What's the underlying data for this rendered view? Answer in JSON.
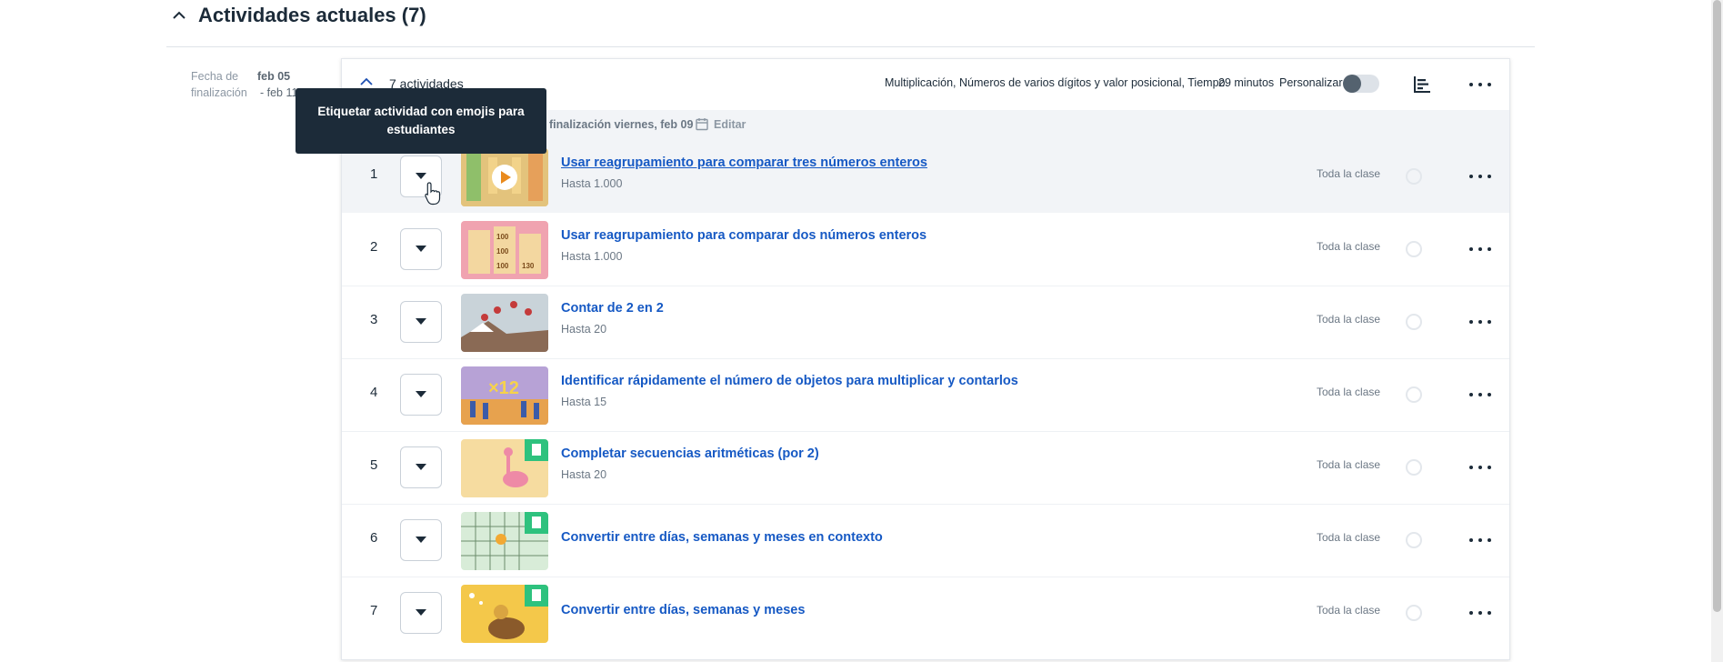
{
  "section": {
    "title": "Actividades actuales (7)"
  },
  "due": {
    "label": "Fecha de finalización",
    "start": "feb 05",
    "end": "- feb 11"
  },
  "card": {
    "count_label": "7 actividades",
    "skills": "Multiplicación, Números de varios dígitos y valor posicional, Tiempo",
    "duration": "29 minutos",
    "personalize_label": "Personalizar",
    "personalize_on": false
  },
  "subbar": {
    "due_text": "finalización viernes, feb 09",
    "edit_label": "Editar"
  },
  "tooltip": {
    "text": "Etiquetar actividad con emojis para estudiantes"
  },
  "activities": [
    {
      "num": "1",
      "title": "Usar reagrupamiento para comparar tres números enteros",
      "sub": "Hasta 1.000",
      "scope": "Toda la clase"
    },
    {
      "num": "2",
      "title": "Usar reagrupamiento para comparar dos números enteros",
      "sub": "Hasta 1.000",
      "scope": "Toda la clase"
    },
    {
      "num": "3",
      "title": "Contar de 2 en 2",
      "sub": "Hasta 20",
      "scope": "Toda la clase"
    },
    {
      "num": "4",
      "title": "Identificar rápidamente el número de objetos para multiplicar y contarlos",
      "sub": "Hasta 15",
      "scope": "Toda la clase"
    },
    {
      "num": "5",
      "title": "Completar secuencias aritméticas (por 2)",
      "sub": "Hasta 20",
      "scope": "Toda la clase"
    },
    {
      "num": "6",
      "title": "Convertir entre días, semanas y meses en contexto",
      "sub": "",
      "scope": "Toda la clase"
    },
    {
      "num": "7",
      "title": "Convertir entre días, semanas y meses",
      "sub": "",
      "scope": "Toda la clase"
    }
  ],
  "thumb_text": {
    "t2a": "100",
    "t2b": "100",
    "t2c": "100",
    "t2d": "130",
    "t4": "×12"
  },
  "colors": {
    "link": "#1659c4",
    "dark": "#1c2b39",
    "muted": "#6b7784",
    "worksheet_badge": "#2ec27e"
  }
}
